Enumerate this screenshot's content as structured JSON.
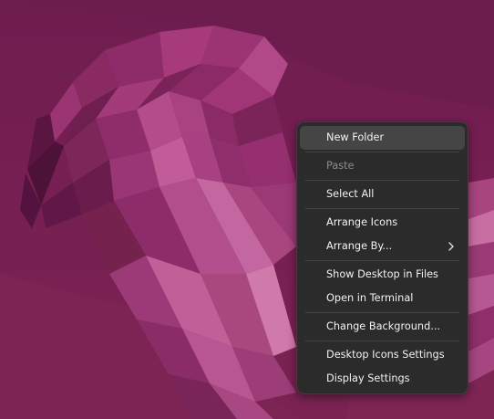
{
  "context_menu": {
    "items": [
      {
        "label": "New Folder",
        "enabled": true,
        "highlighted": true
      },
      {
        "label": "Paste",
        "enabled": false
      },
      {
        "label": "Select All",
        "enabled": true
      },
      {
        "label": "Arrange Icons",
        "enabled": true
      },
      {
        "label": "Arrange By...",
        "enabled": true,
        "submenu": true
      },
      {
        "label": "Show Desktop in Files",
        "enabled": true
      },
      {
        "label": "Open in Terminal",
        "enabled": true
      },
      {
        "label": "Change Background...",
        "enabled": true
      },
      {
        "label": "Desktop Icons Settings",
        "enabled": true
      },
      {
        "label": "Display Settings",
        "enabled": true
      }
    ],
    "submenu_icon": "chevron-right-icon"
  },
  "colors": {
    "menu_background": "#2b2b2b",
    "menu_hover": "#454545",
    "menu_text": "#f2f2f2",
    "menu_disabled_text": "#8c8c8c",
    "wallpaper_base": "#731f51"
  }
}
